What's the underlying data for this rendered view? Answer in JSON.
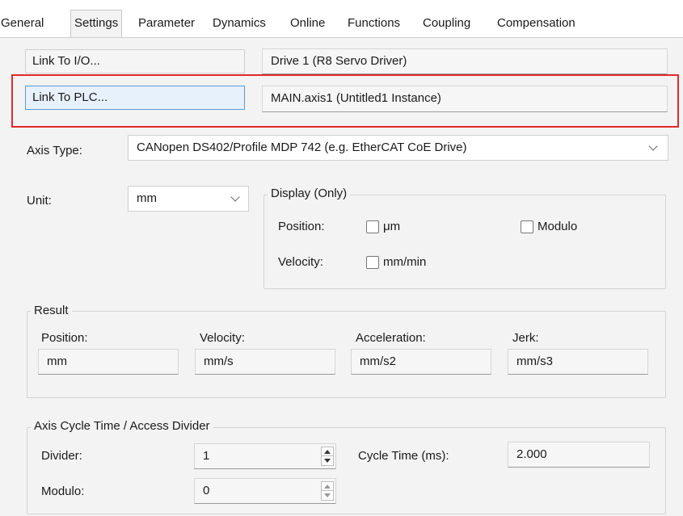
{
  "tabs": [
    {
      "label": "General"
    },
    {
      "label": "Settings",
      "active": true
    },
    {
      "label": "Parameter"
    },
    {
      "label": "Dynamics"
    },
    {
      "label": "Online"
    },
    {
      "label": "Functions"
    },
    {
      "label": "Coupling"
    },
    {
      "label": "Compensation"
    }
  ],
  "links": {
    "io_button": "Link To I/O...",
    "io_value": "Drive 1 (R8 Servo Driver)",
    "plc_button": "Link To PLC...",
    "plc_value": "MAIN.axis1 (Untitled1 Instance)"
  },
  "axis_type": {
    "label": "Axis Type:",
    "value": "CANopen DS402/Profile MDP 742 (e.g. EtherCAT CoE Drive)"
  },
  "unit": {
    "label": "Unit:",
    "value": "mm"
  },
  "display": {
    "title": "Display (Only)",
    "position_label": "Position:",
    "position_option": "μm",
    "modulo_option": "Modulo",
    "velocity_label": "Velocity:",
    "velocity_option": "mm/min"
  },
  "result": {
    "title": "Result",
    "columns": [
      {
        "label": "Position:",
        "value": "mm"
      },
      {
        "label": "Velocity:",
        "value": "mm/s"
      },
      {
        "label": "Acceleration:",
        "value": "mm/s2"
      },
      {
        "label": "Jerk:",
        "value": "mm/s3"
      }
    ]
  },
  "cycle": {
    "title": "Axis Cycle Time / Access Divider",
    "divider_label": "Divider:",
    "divider_value": "1",
    "modulo_label": "Modulo:",
    "modulo_value": "0",
    "cycle_time_label": "Cycle Time (ms):",
    "cycle_time_value": "2.000"
  },
  "colors": {
    "highlight": "#e02a2a",
    "panel_bg": "#f3f3f3",
    "focus_border": "#5b9bd5"
  }
}
